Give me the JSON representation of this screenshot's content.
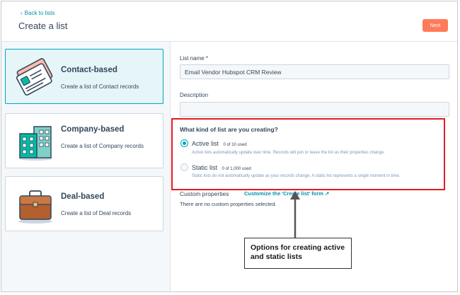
{
  "header": {
    "back_label": "Back to lists",
    "title": "Create a list",
    "next_label": "Next"
  },
  "cards": [
    {
      "title": "Contact-based",
      "description": "Create a list of Contact records",
      "icon": "contact-cards-icon",
      "selected": true
    },
    {
      "title": "Company-based",
      "description": "Create a list of Company records",
      "icon": "building-icon",
      "selected": false
    },
    {
      "title": "Deal-based",
      "description": "Create a list of Deal records",
      "icon": "briefcase-icon",
      "selected": false
    }
  ],
  "form": {
    "list_name_label": "List name *",
    "list_name_value": "Email Vendor Hubspot CRM Review",
    "description_label": "Description",
    "description_value": "",
    "question": "What kind of list are you creating?",
    "options": [
      {
        "label": "Active list",
        "used": "0 of 10 used",
        "help": "Active lists automatically update over time. Records will join or leave the list as their properties change.",
        "selected": true
      },
      {
        "label": "Static list",
        "used": "0 of 1,000 used",
        "help": "Static lists do not automatically update as your records change. A static list represents a single moment in time.",
        "selected": false
      }
    ],
    "custom_properties_label": "Custom properties",
    "custom_properties_link": "Customize the 'Create list' form",
    "custom_properties_empty": "There are no custom properties selected."
  },
  "annotation": {
    "callout": "Options for creating active and static lists",
    "highlight_color": "#e31b23"
  },
  "colors": {
    "accent": "#00a4bd",
    "link": "#0091ae",
    "cta": "#ff7a59",
    "text": "#33475b"
  }
}
